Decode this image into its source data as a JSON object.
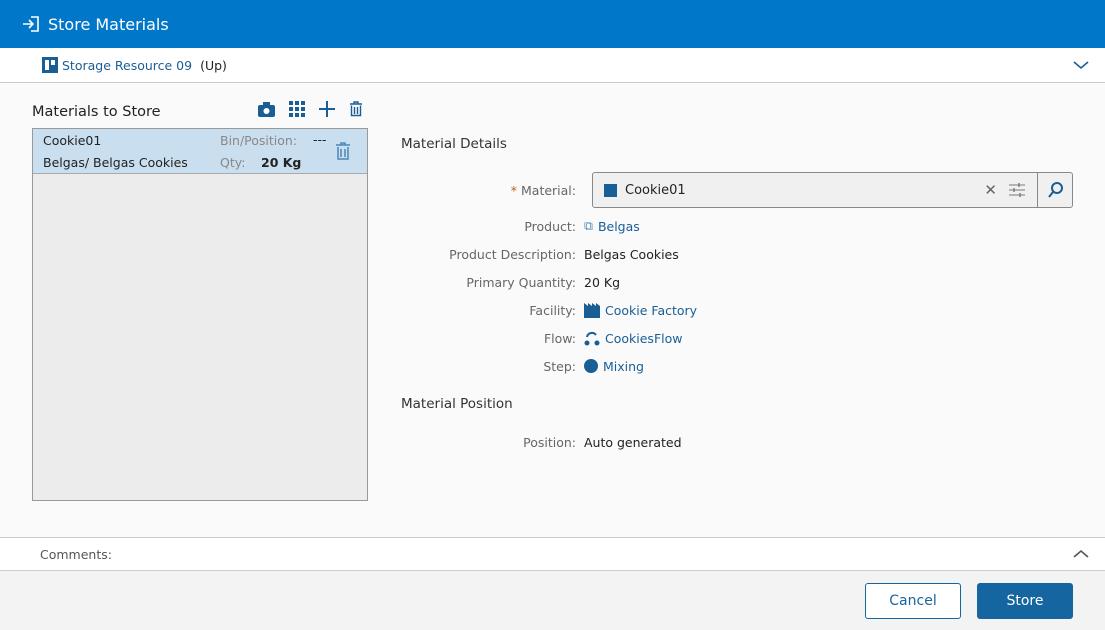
{
  "title": "Store Materials",
  "resource": {
    "name": "Storage Resource 09",
    "state": "(Up)"
  },
  "left": {
    "title": "Materials to Store",
    "items": [
      {
        "name": "Cookie01",
        "product": "Belgas/ Belgas Cookies",
        "bin_label": "Bin/Position:",
        "bin_value": "---",
        "qty_label": "Qty:",
        "qty_value": "20 Kg"
      }
    ]
  },
  "details": {
    "section_title": "Material Details",
    "required_mark": "*",
    "material_label": "Material:",
    "material_value": "Cookie01",
    "product_label": "Product:",
    "product_value": "Belgas",
    "desc_label": "Product Description:",
    "desc_value": "Belgas Cookies",
    "qty_label": "Primary Quantity:",
    "qty_value": "20 Kg",
    "facility_label": "Facility:",
    "facility_value": "Cookie Factory",
    "flow_label": "Flow:",
    "flow_value": "CookiesFlow",
    "step_label": "Step:",
    "step_value": "Mixing"
  },
  "position": {
    "section_title": "Material Position",
    "label": "Position:",
    "value": "Auto generated"
  },
  "comments_label": "Comments:",
  "buttons": {
    "cancel": "Cancel",
    "store": "Store"
  },
  "colors": {
    "accent": "#0077c8",
    "link": "#1a5e96",
    "button": "#1565a0"
  }
}
